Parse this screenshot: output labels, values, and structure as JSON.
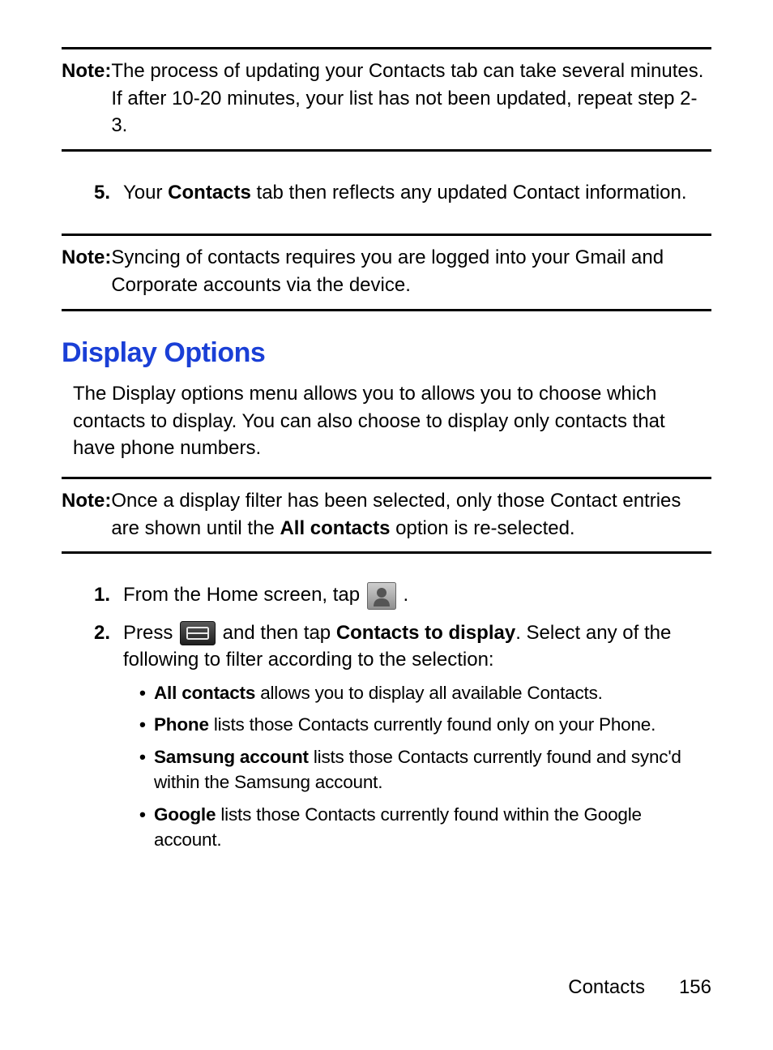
{
  "note1": {
    "label": "Note:",
    "text": "The process of updating your Contacts tab can take several minutes. If after 10-20 minutes, your list has not been updated, repeat step 2-3."
  },
  "step5": {
    "num": "5.",
    "pre": "Your ",
    "bold": "Contacts",
    "post": " tab then reflects any updated Contact information."
  },
  "note2": {
    "label": "Note:",
    "text": "Syncing of contacts requires you are logged into your Gmail and Corporate accounts via the device."
  },
  "heading": "Display Options",
  "intro": "The Display options menu allows you to allows you to choose which contacts to display. You can also choose to display only contacts that have phone numbers.",
  "note3": {
    "label": "Note:",
    "pre": "Once a display filter has been selected, only those Contact entries are shown until the ",
    "bold": "All contacts",
    "post": " option is re-selected."
  },
  "step1": {
    "num": "1.",
    "pre": "From the Home screen, tap ",
    "post": " ."
  },
  "step2": {
    "num": "2.",
    "pre": "Press ",
    "mid": " and then tap ",
    "bold": "Contacts to display",
    "post": ". Select any of the following to filter according to the selection:"
  },
  "bullets": [
    {
      "bold": "All contacts",
      "text": " allows you to display all available Contacts."
    },
    {
      "bold": "Phone",
      "text": " lists those Contacts currently found only on your Phone."
    },
    {
      "bold": "Samsung account",
      "text": " lists those Contacts currently found and sync'd within the Samsung account."
    },
    {
      "bold": "Google",
      "text": " lists those Contacts currently found within the Google account."
    }
  ],
  "footer": {
    "section": "Contacts",
    "page": "156"
  }
}
